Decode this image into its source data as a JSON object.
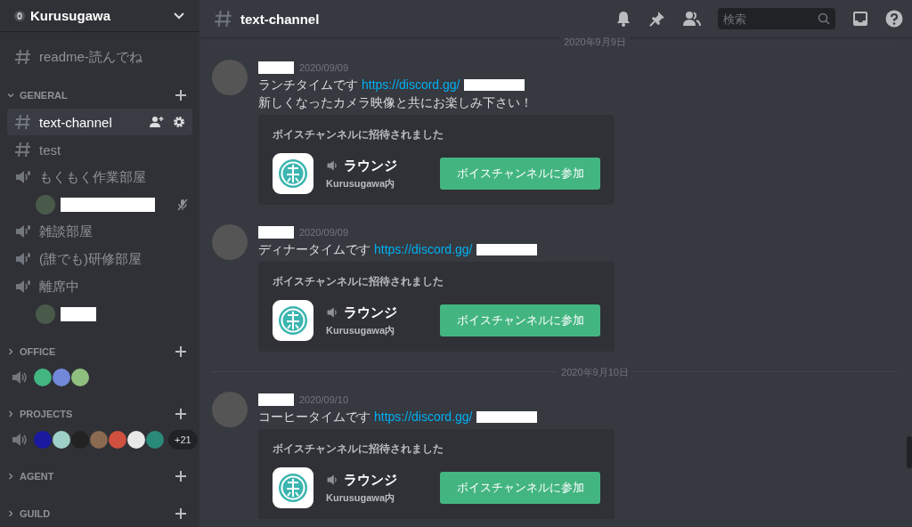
{
  "server": {
    "name": "Kurusugawa"
  },
  "sidebar": {
    "items": [
      {
        "kind": "text",
        "label": "readme-読んでね",
        "selected": false
      },
      {
        "kind": "category",
        "label": "GENERAL",
        "expanded": true
      },
      {
        "kind": "text",
        "label": "text-channel",
        "selected": true
      },
      {
        "kind": "text",
        "label": "test",
        "selected": false
      },
      {
        "kind": "voice",
        "label": "もくもく作業部屋",
        "selected": false,
        "children": [
          {
            "muted": true
          }
        ]
      },
      {
        "kind": "voice",
        "label": "雑談部屋",
        "selected": false
      },
      {
        "kind": "voice",
        "label": "(誰でも)研修部屋",
        "selected": false
      },
      {
        "kind": "voice",
        "label": "離席中",
        "selected": false,
        "children": [
          {
            "muted": false
          }
        ]
      },
      {
        "kind": "category",
        "label": "OFFICE",
        "expanded": false
      },
      {
        "kind": "avatars",
        "avatars": [
          {
            "color": "#43b581"
          },
          {
            "color": "#7289da"
          },
          {
            "color": "#8fbf7f"
          }
        ]
      },
      {
        "kind": "category",
        "label": "PROJECTS",
        "expanded": false
      },
      {
        "kind": "avatars",
        "avatars": [
          {
            "color": "#1a1aa0"
          },
          {
            "color": "#9fd0c8"
          },
          {
            "color": "#222222"
          },
          {
            "color": "#8a6a50"
          },
          {
            "color": "#d05040"
          },
          {
            "color": "#e8e8e8"
          },
          {
            "color": "#2a8a7a"
          }
        ],
        "more": "+21"
      },
      {
        "kind": "category",
        "label": "AGENT",
        "expanded": false
      },
      {
        "kind": "category",
        "label": "GUILD",
        "expanded": false
      }
    ]
  },
  "header": {
    "channel": "text-channel",
    "search": {
      "placeholder": "検索"
    }
  },
  "messages": [
    {
      "kind": "divider",
      "label": "2020年9月9日"
    },
    {
      "kind": "message",
      "timestamp": "2020/09/09",
      "text": "ランチタイムです",
      "link": "https://discord.gg/",
      "lines": [
        "新しくなったカメラ映像と共にお楽しみ下さい！"
      ],
      "invite": {
        "heading": "ボイスチャンネルに招待されました",
        "channel": "ラウンジ",
        "server": "Kurusugawa内",
        "button": "ボイスチャンネルに参加"
      }
    },
    {
      "kind": "message",
      "timestamp": "2020/09/09",
      "text": "ディナータイムです",
      "link": "https://discord.gg/",
      "invite": {
        "heading": "ボイスチャンネルに招待されました",
        "channel": "ラウンジ",
        "server": "Kurusugawa内",
        "button": "ボイスチャンネルに参加"
      }
    },
    {
      "kind": "divider",
      "label": "2020年9月10日"
    },
    {
      "kind": "message",
      "timestamp": "2020/09/10",
      "text": "コーヒータイムです",
      "link": "https://discord.gg/",
      "invite": {
        "heading": "ボイスチャンネルに招待されました",
        "channel": "ラウンジ",
        "server": "Kurusugawa内",
        "button": "ボイスチャンネルに参加"
      }
    }
  ]
}
